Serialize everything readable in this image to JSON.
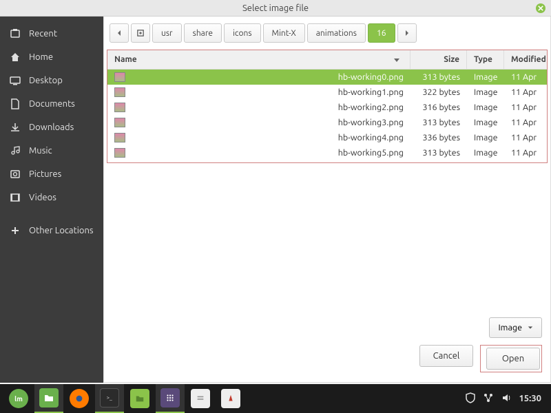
{
  "title": "Select image file",
  "sidebar": {
    "items": [
      {
        "label": "Recent",
        "icon": "recent"
      },
      {
        "label": "Home",
        "icon": "home"
      },
      {
        "label": "Desktop",
        "icon": "desktop"
      },
      {
        "label": "Documents",
        "icon": "documents"
      },
      {
        "label": "Downloads",
        "icon": "downloads"
      },
      {
        "label": "Music",
        "icon": "music"
      },
      {
        "label": "Pictures",
        "icon": "pictures"
      },
      {
        "label": "Videos",
        "icon": "videos"
      }
    ],
    "other": "Other Locations"
  },
  "breadcrumb": [
    "usr",
    "share",
    "icons",
    "Mint-X",
    "animations",
    "16"
  ],
  "columns": {
    "name": "Name",
    "size": "Size",
    "type": "Type",
    "modified": "Modified"
  },
  "files": [
    {
      "name": "hb-working0.png",
      "size": "313 bytes",
      "type": "Image",
      "modified": "11 Apr",
      "selected": true
    },
    {
      "name": "hb-working1.png",
      "size": "322 bytes",
      "type": "Image",
      "modified": "11 Apr",
      "selected": false
    },
    {
      "name": "hb-working2.png",
      "size": "316 bytes",
      "type": "Image",
      "modified": "11 Apr",
      "selected": false
    },
    {
      "name": "hb-working3.png",
      "size": "313 bytes",
      "type": "Image",
      "modified": "11 Apr",
      "selected": false
    },
    {
      "name": "hb-working4.png",
      "size": "336 bytes",
      "type": "Image",
      "modified": "11 Apr",
      "selected": false
    },
    {
      "name": "hb-working5.png",
      "size": "313 bytes",
      "type": "Image",
      "modified": "11 Apr",
      "selected": false
    }
  ],
  "filter": "Image",
  "buttons": {
    "cancel": "Cancel",
    "open": "Open"
  },
  "clock": "15:30"
}
